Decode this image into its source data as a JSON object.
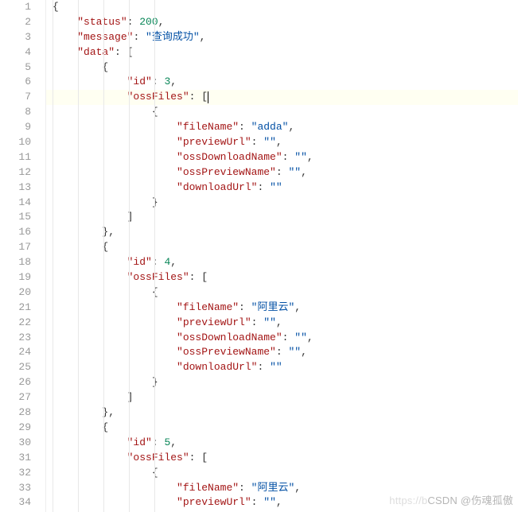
{
  "lineCount": 34,
  "cursorLine": 7,
  "indentGuides": [
    67,
    99,
    131,
    163,
    195
  ],
  "code": {
    "l1": [
      {
        "t": "{",
        "c": "punc"
      }
    ],
    "l2": [
      {
        "t": "    ",
        "c": ""
      },
      {
        "t": "\"status\"",
        "c": "key"
      },
      {
        "t": ": ",
        "c": "punc"
      },
      {
        "t": "200",
        "c": "num"
      },
      {
        "t": ",",
        "c": "punc"
      }
    ],
    "l3": [
      {
        "t": "    ",
        "c": ""
      },
      {
        "t": "\"message\"",
        "c": "key"
      },
      {
        "t": ": ",
        "c": "punc"
      },
      {
        "t": "\"查询成功\"",
        "c": "str"
      },
      {
        "t": ",",
        "c": "punc"
      }
    ],
    "l4": [
      {
        "t": "    ",
        "c": ""
      },
      {
        "t": "\"data\"",
        "c": "key"
      },
      {
        "t": ": [",
        "c": "punc"
      }
    ],
    "l5": [
      {
        "t": "        ",
        "c": ""
      },
      {
        "t": "{",
        "c": "punc"
      }
    ],
    "l6": [
      {
        "t": "            ",
        "c": ""
      },
      {
        "t": "\"id\"",
        "c": "key"
      },
      {
        "t": ": ",
        "c": "punc"
      },
      {
        "t": "3",
        "c": "num"
      },
      {
        "t": ",",
        "c": "punc"
      }
    ],
    "l7": [
      {
        "t": "            ",
        "c": ""
      },
      {
        "t": "\"ossFiles\"",
        "c": "key"
      },
      {
        "t": ": [",
        "c": "punc"
      }
    ],
    "l8": [
      {
        "t": "                ",
        "c": ""
      },
      {
        "t": "{",
        "c": "punc"
      }
    ],
    "l9": [
      {
        "t": "                    ",
        "c": ""
      },
      {
        "t": "\"fileName\"",
        "c": "key"
      },
      {
        "t": ": ",
        "c": "punc"
      },
      {
        "t": "\"adda\"",
        "c": "str"
      },
      {
        "t": ",",
        "c": "punc"
      }
    ],
    "l10": [
      {
        "t": "                    ",
        "c": ""
      },
      {
        "t": "\"previewUrl\"",
        "c": "key"
      },
      {
        "t": ": ",
        "c": "punc"
      },
      {
        "t": "\"\"",
        "c": "str"
      },
      {
        "t": ",",
        "c": "punc"
      }
    ],
    "l11": [
      {
        "t": "                    ",
        "c": ""
      },
      {
        "t": "\"ossDownloadName\"",
        "c": "key"
      },
      {
        "t": ": ",
        "c": "punc"
      },
      {
        "t": "\"\"",
        "c": "str"
      },
      {
        "t": ",",
        "c": "punc"
      }
    ],
    "l12": [
      {
        "t": "                    ",
        "c": ""
      },
      {
        "t": "\"ossPreviewName\"",
        "c": "key"
      },
      {
        "t": ": ",
        "c": "punc"
      },
      {
        "t": "\"\"",
        "c": "str"
      },
      {
        "t": ",",
        "c": "punc"
      }
    ],
    "l13": [
      {
        "t": "                    ",
        "c": ""
      },
      {
        "t": "\"downloadUrl\"",
        "c": "key"
      },
      {
        "t": ": ",
        "c": "punc"
      },
      {
        "t": "\"\"",
        "c": "str"
      }
    ],
    "l14": [
      {
        "t": "                ",
        "c": ""
      },
      {
        "t": "}",
        "c": "punc"
      }
    ],
    "l15": [
      {
        "t": "            ",
        "c": ""
      },
      {
        "t": "]",
        "c": "punc"
      }
    ],
    "l16": [
      {
        "t": "        ",
        "c": ""
      },
      {
        "t": "},",
        "c": "punc"
      }
    ],
    "l17": [
      {
        "t": "        ",
        "c": ""
      },
      {
        "t": "{",
        "c": "punc"
      }
    ],
    "l18": [
      {
        "t": "            ",
        "c": ""
      },
      {
        "t": "\"id\"",
        "c": "key"
      },
      {
        "t": ": ",
        "c": "punc"
      },
      {
        "t": "4",
        "c": "num"
      },
      {
        "t": ",",
        "c": "punc"
      }
    ],
    "l19": [
      {
        "t": "            ",
        "c": ""
      },
      {
        "t": "\"ossFiles\"",
        "c": "key"
      },
      {
        "t": ": [",
        "c": "punc"
      }
    ],
    "l20": [
      {
        "t": "                ",
        "c": ""
      },
      {
        "t": "{",
        "c": "punc"
      }
    ],
    "l21": [
      {
        "t": "                    ",
        "c": ""
      },
      {
        "t": "\"fileName\"",
        "c": "key"
      },
      {
        "t": ": ",
        "c": "punc"
      },
      {
        "t": "\"阿里云\"",
        "c": "str"
      },
      {
        "t": ",",
        "c": "punc"
      }
    ],
    "l22": [
      {
        "t": "                    ",
        "c": ""
      },
      {
        "t": "\"previewUrl\"",
        "c": "key"
      },
      {
        "t": ": ",
        "c": "punc"
      },
      {
        "t": "\"\"",
        "c": "str"
      },
      {
        "t": ",",
        "c": "punc"
      }
    ],
    "l23": [
      {
        "t": "                    ",
        "c": ""
      },
      {
        "t": "\"ossDownloadName\"",
        "c": "key"
      },
      {
        "t": ": ",
        "c": "punc"
      },
      {
        "t": "\"\"",
        "c": "str"
      },
      {
        "t": ",",
        "c": "punc"
      }
    ],
    "l24": [
      {
        "t": "                    ",
        "c": ""
      },
      {
        "t": "\"ossPreviewName\"",
        "c": "key"
      },
      {
        "t": ": ",
        "c": "punc"
      },
      {
        "t": "\"\"",
        "c": "str"
      },
      {
        "t": ",",
        "c": "punc"
      }
    ],
    "l25": [
      {
        "t": "                    ",
        "c": ""
      },
      {
        "t": "\"downloadUrl\"",
        "c": "key"
      },
      {
        "t": ": ",
        "c": "punc"
      },
      {
        "t": "\"\"",
        "c": "str"
      }
    ],
    "l26": [
      {
        "t": "                ",
        "c": ""
      },
      {
        "t": "}",
        "c": "punc"
      }
    ],
    "l27": [
      {
        "t": "            ",
        "c": ""
      },
      {
        "t": "]",
        "c": "punc"
      }
    ],
    "l28": [
      {
        "t": "        ",
        "c": ""
      },
      {
        "t": "},",
        "c": "punc"
      }
    ],
    "l29": [
      {
        "t": "        ",
        "c": ""
      },
      {
        "t": "{",
        "c": "punc"
      }
    ],
    "l30": [
      {
        "t": "            ",
        "c": ""
      },
      {
        "t": "\"id\"",
        "c": "key"
      },
      {
        "t": ": ",
        "c": "punc"
      },
      {
        "t": "5",
        "c": "num"
      },
      {
        "t": ",",
        "c": "punc"
      }
    ],
    "l31": [
      {
        "t": "            ",
        "c": ""
      },
      {
        "t": "\"ossFiles\"",
        "c": "key"
      },
      {
        "t": ": [",
        "c": "punc"
      }
    ],
    "l32": [
      {
        "t": "                ",
        "c": ""
      },
      {
        "t": "{",
        "c": "punc"
      }
    ],
    "l33": [
      {
        "t": "                    ",
        "c": ""
      },
      {
        "t": "\"fileName\"",
        "c": "key"
      },
      {
        "t": ": ",
        "c": "punc"
      },
      {
        "t": "\"阿里云\"",
        "c": "str"
      },
      {
        "t": ",",
        "c": "punc"
      }
    ],
    "l34": [
      {
        "t": "                    ",
        "c": ""
      },
      {
        "t": "\"previewUrl\"",
        "c": "key"
      },
      {
        "t": ": ",
        "c": "punc"
      },
      {
        "t": "\"\"",
        "c": "str"
      },
      {
        "t": ",",
        "c": "punc"
      }
    ]
  },
  "watermark": {
    "faint": "https://b",
    "main": "CSDN @伤魂孤傲"
  }
}
